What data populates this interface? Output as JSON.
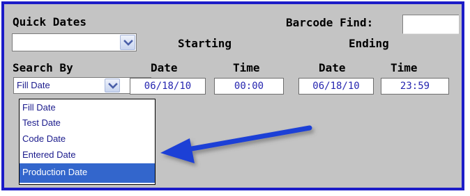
{
  "labels": {
    "quick_dates": "Quick Dates",
    "barcode_find": "Barcode Find:",
    "starting": "Starting",
    "ending": "Ending",
    "search_by": "Search By",
    "start_date": "Date",
    "start_time": "Time",
    "end_date": "Date",
    "end_time": "Time"
  },
  "quick_dates_select": {
    "value": ""
  },
  "barcode_find_input": {
    "value": ""
  },
  "search_by_select": {
    "value": "Fill Date",
    "options": [
      "Fill Date",
      "Test Date",
      "Code Date",
      "Entered Date",
      "Production Date"
    ],
    "highlighted_index": 4
  },
  "starting": {
    "date": "06/18/10",
    "time": "00:00"
  },
  "ending": {
    "date": "06/18/10",
    "time": "23:59"
  },
  "colors": {
    "border_blue": "#1c1cc8",
    "panel_gray": "#c4c4c4",
    "field_text": "#2626b0",
    "highlight": "#3366cc",
    "arrow": "#1f3fd6"
  },
  "icons": {
    "dropdown_arrow": "chevron-down-icon",
    "annotation_arrow": "arrow-left-icon"
  }
}
